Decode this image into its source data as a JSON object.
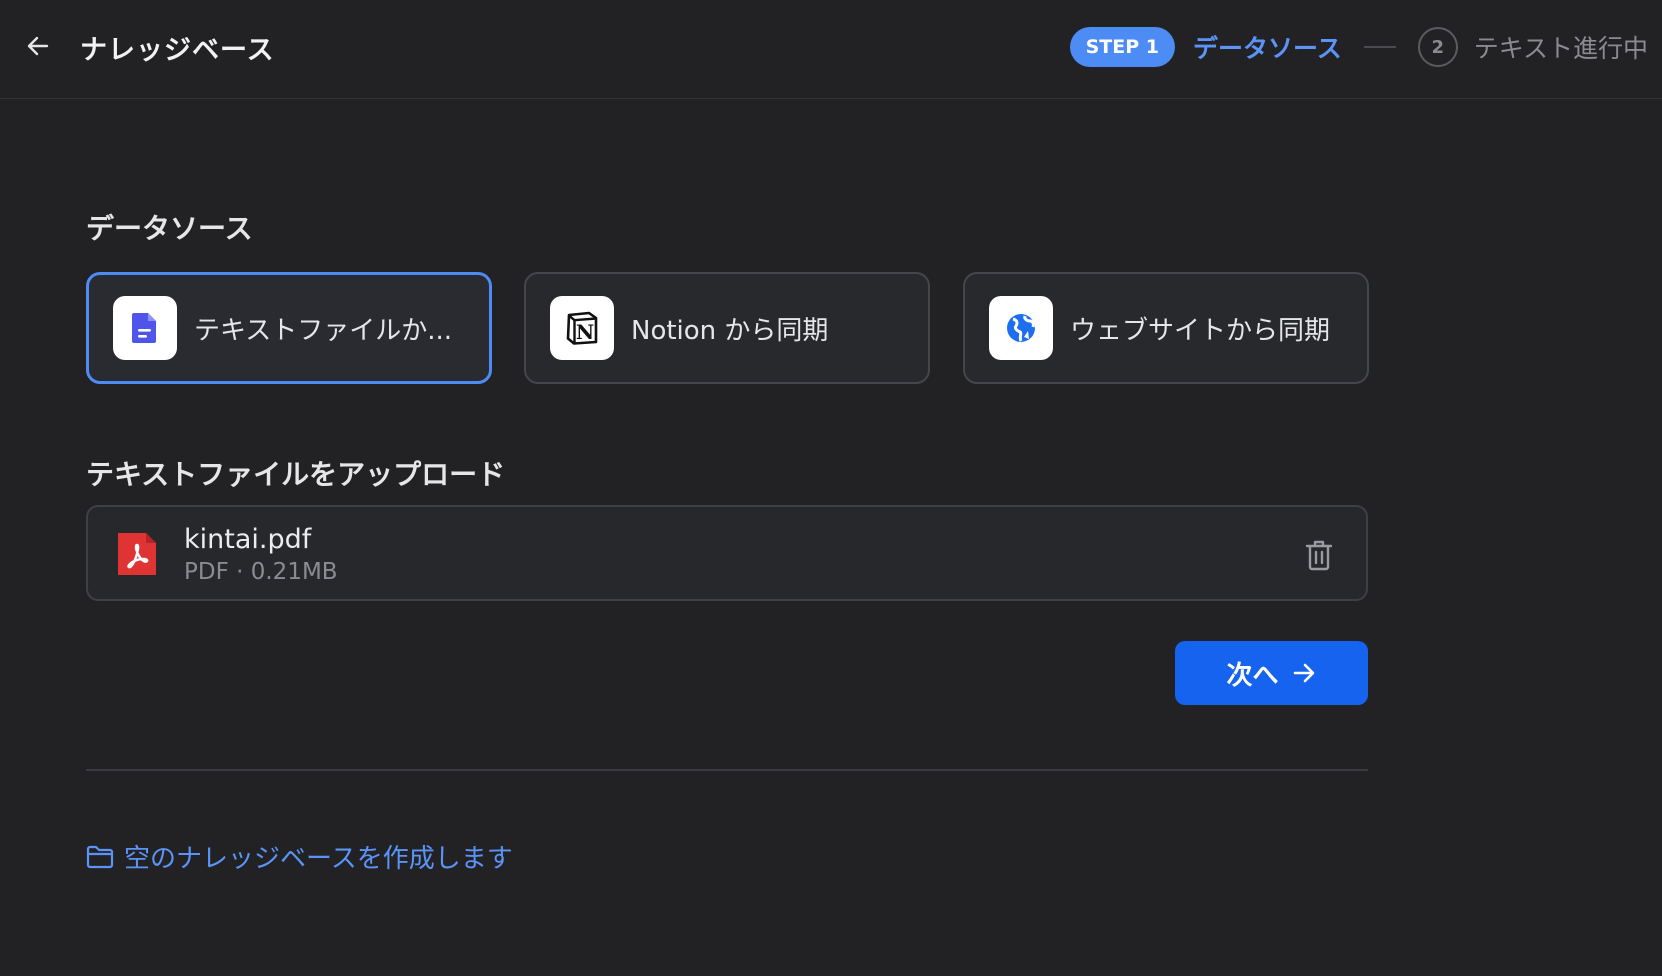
{
  "header": {
    "title": "ナレッジベース",
    "steps": {
      "active_badge": "STEP 1",
      "active_label": "データソース",
      "next_number": "2",
      "next_label": "テキスト進行中"
    }
  },
  "datasource": {
    "title": "データソース",
    "options": [
      {
        "label": "テキストファイルか...",
        "icon": "document-icon",
        "selected": true
      },
      {
        "label": "Notion から同期",
        "icon": "notion-icon",
        "selected": false
      },
      {
        "label": "ウェブサイトから同期",
        "icon": "globe-icon",
        "selected": false
      }
    ]
  },
  "upload": {
    "title": "テキストファイルをアップロード",
    "file": {
      "name": "kintai.pdf",
      "meta": "PDF · 0.21MB",
      "icon": "pdf-icon"
    }
  },
  "actions": {
    "next_label": "次へ"
  },
  "footer": {
    "empty_kb_link": "空のナレッジベースを作成します"
  },
  "colors": {
    "background": "#222225",
    "accent": "#4d8bf5",
    "primary_button": "#1663f0",
    "pdf_red": "#e03434"
  }
}
